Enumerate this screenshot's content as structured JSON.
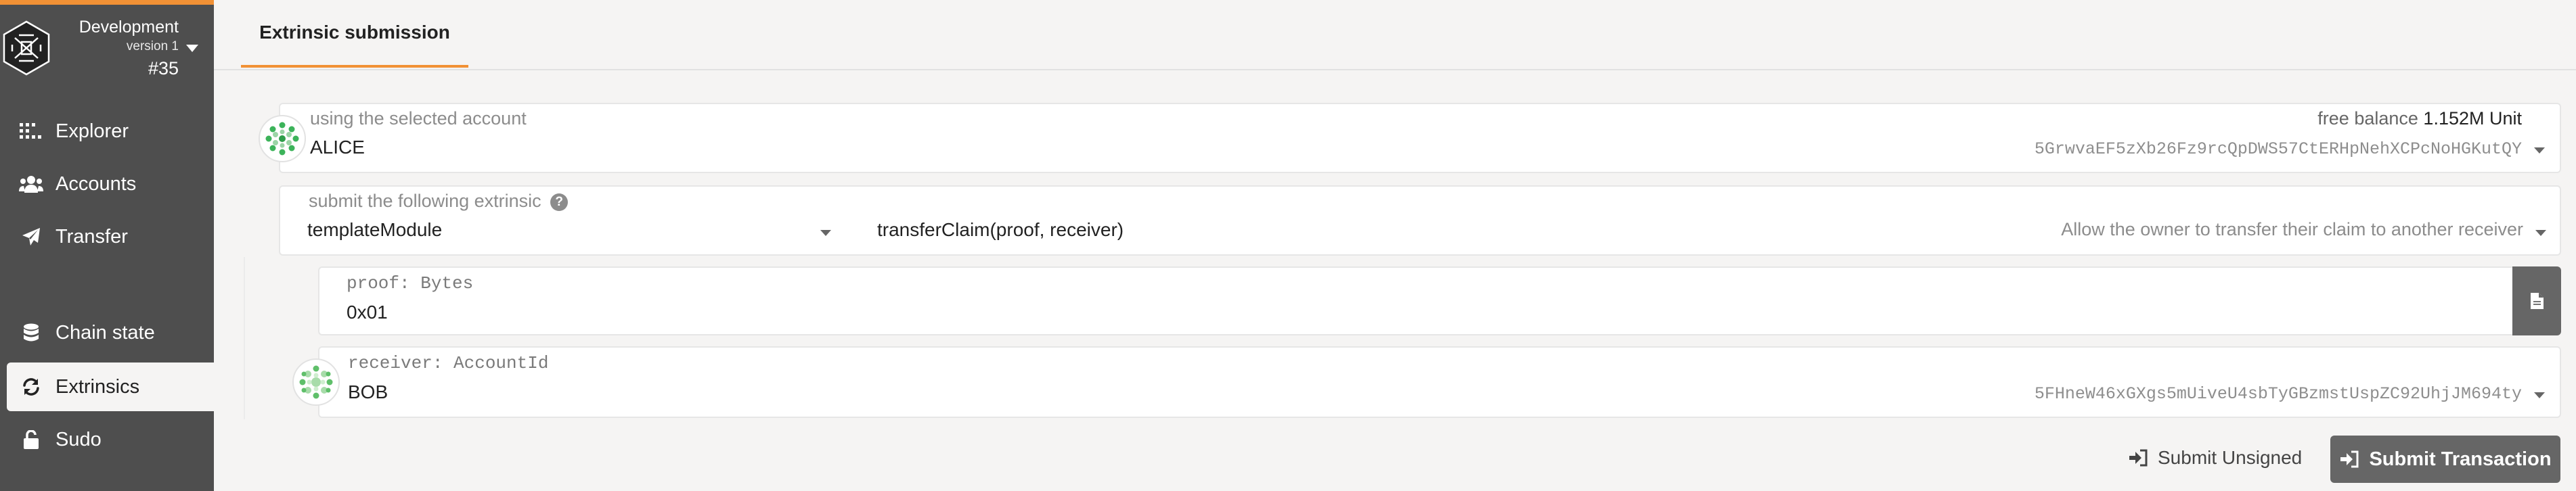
{
  "chain": {
    "name": "Development",
    "version": "version 1",
    "block": "#35"
  },
  "sidebar": {
    "items": [
      {
        "label": "Explorer",
        "icon": "explorer-icon"
      },
      {
        "label": "Accounts",
        "icon": "users-icon"
      },
      {
        "label": "Transfer",
        "icon": "send-icon"
      },
      {
        "label": "Chain state",
        "icon": "database-icon"
      },
      {
        "label": "Extrinsics",
        "icon": "sync-icon",
        "active": true
      },
      {
        "label": "Sudo",
        "icon": "unlock-icon"
      }
    ]
  },
  "tabs": [
    {
      "label": "Extrinsic submission",
      "active": true
    }
  ],
  "account": {
    "label": "using the selected account",
    "name": "ALICE",
    "balance_label": "free balance",
    "balance_value": "1.152M Unit",
    "address": "5GrwvaEF5zXb26Fz9rcQpDWS57CtERHpNehXCPcNoHGKutQY"
  },
  "extrinsic": {
    "label": "submit the following extrinsic",
    "module": "templateModule",
    "call": "transferClaim(proof, receiver)",
    "description": "Allow the owner to transfer their claim to another receiver"
  },
  "params": {
    "proof": {
      "label": "proof: Bytes",
      "value": "0x01"
    },
    "receiver": {
      "label": "receiver: AccountId",
      "name": "BOB",
      "address": "5FHneW46xGXgs5mUiveU4sbTyGBzmstUspZC92UhjJM694ty"
    }
  },
  "actions": {
    "unsigned": "Submit Unsigned",
    "submit": "Submit Transaction"
  },
  "colors": {
    "accent": "#f19135",
    "sidebar": "#4e4e4e",
    "button": "#666666"
  }
}
